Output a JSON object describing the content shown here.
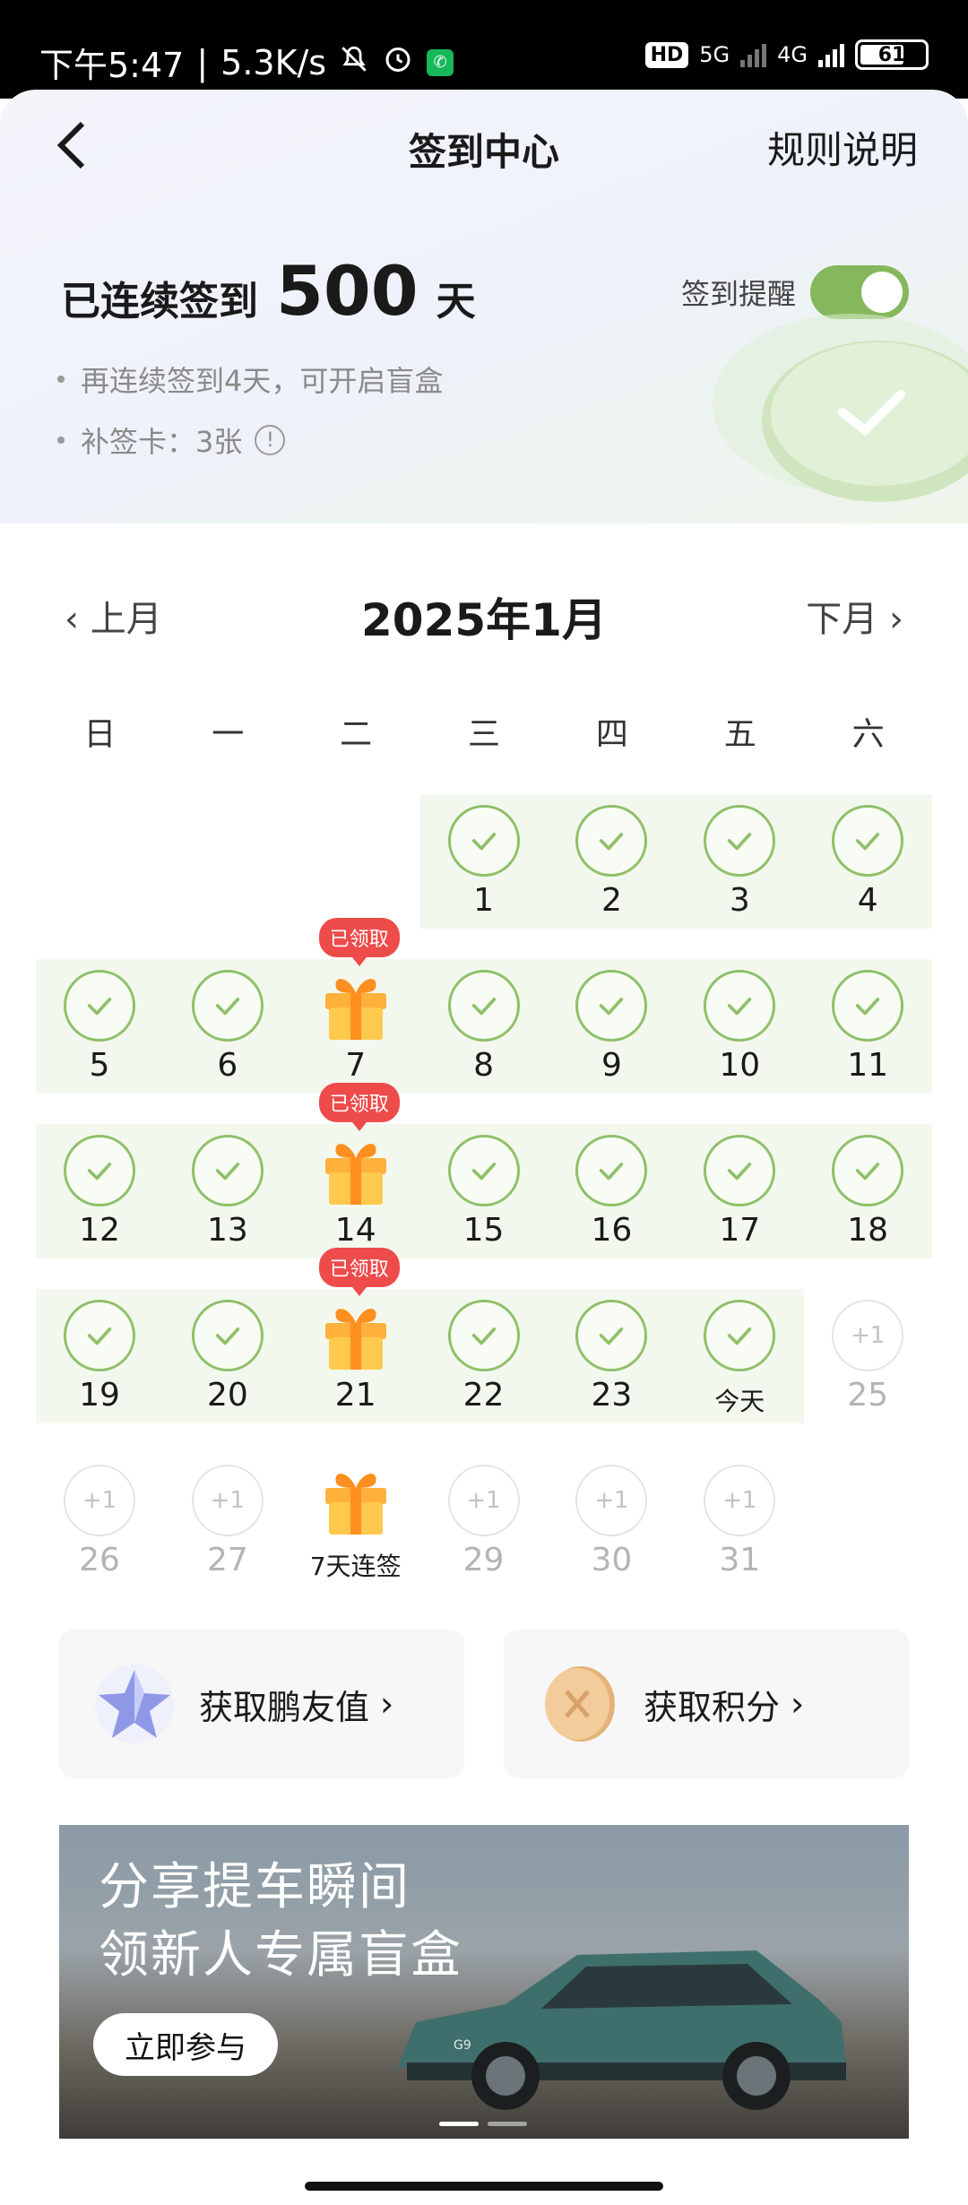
{
  "status_bar": {
    "time": "下午5:47",
    "speed": "5.3K/s",
    "hd_badge": "HD",
    "net1": "5G",
    "net2": "4G",
    "battery": "61"
  },
  "nav": {
    "back_icon": "back-arrow-icon",
    "title": "签到中心",
    "rules": "规则说明"
  },
  "summary": {
    "prefix": "已连续签到",
    "days": "500",
    "unit": "天",
    "reminder_label": "签到提醒",
    "reminder_on": true,
    "tip1": "再连续签到4天，可开启盲盒",
    "tip2": "补签卡：3张"
  },
  "calendar": {
    "prev": "上月",
    "next": "下月",
    "month": "2025年1月",
    "weekdays": [
      "日",
      "一",
      "二",
      "三",
      "四",
      "五",
      "六"
    ],
    "claimed_label": "已领取",
    "plus_label": "+1",
    "today_label": "今天",
    "streak_gift_label": "7天连签",
    "days": [
      {
        "d": "1",
        "s": "checked"
      },
      {
        "d": "2",
        "s": "checked"
      },
      {
        "d": "3",
        "s": "checked"
      },
      {
        "d": "4",
        "s": "checked"
      },
      {
        "d": "5",
        "s": "checked"
      },
      {
        "d": "6",
        "s": "checked"
      },
      {
        "d": "7",
        "s": "gift-claimed"
      },
      {
        "d": "8",
        "s": "checked"
      },
      {
        "d": "9",
        "s": "checked"
      },
      {
        "d": "10",
        "s": "checked"
      },
      {
        "d": "11",
        "s": "checked"
      },
      {
        "d": "12",
        "s": "checked"
      },
      {
        "d": "13",
        "s": "checked"
      },
      {
        "d": "14",
        "s": "gift-claimed"
      },
      {
        "d": "15",
        "s": "checked"
      },
      {
        "d": "16",
        "s": "checked"
      },
      {
        "d": "17",
        "s": "checked"
      },
      {
        "d": "18",
        "s": "checked"
      },
      {
        "d": "19",
        "s": "checked"
      },
      {
        "d": "20",
        "s": "checked"
      },
      {
        "d": "21",
        "s": "gift-claimed"
      },
      {
        "d": "22",
        "s": "checked"
      },
      {
        "d": "23",
        "s": "checked"
      },
      {
        "d": "今天",
        "s": "today"
      },
      {
        "d": "25",
        "s": "future"
      },
      {
        "d": "26",
        "s": "future"
      },
      {
        "d": "27",
        "s": "future"
      },
      {
        "d": "7天连签",
        "s": "gift-upcoming"
      },
      {
        "d": "29",
        "s": "future"
      },
      {
        "d": "30",
        "s": "future"
      },
      {
        "d": "31",
        "s": "future"
      }
    ]
  },
  "cards": [
    {
      "label": "获取鹏友值",
      "icon": "star-crystal-icon"
    },
    {
      "label": "获取积分",
      "icon": "gold-coin-icon"
    }
  ],
  "banner": {
    "line1": "分享提车瞬间",
    "line2": "领新人专属盲盒",
    "cta": "立即参与",
    "car_badge": "G9"
  },
  "colors": {
    "accent_green": "#85b85c",
    "claimed_red": "#ee4b4b"
  }
}
